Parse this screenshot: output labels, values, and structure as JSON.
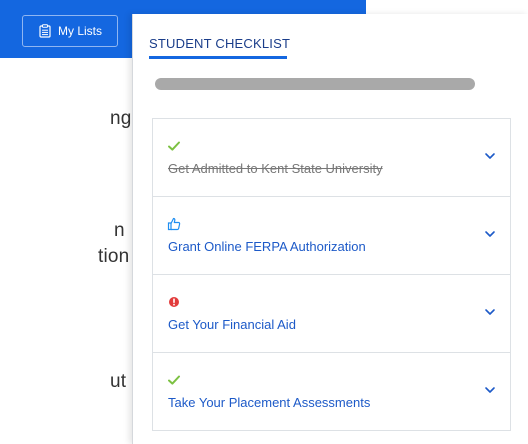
{
  "header": {
    "my_lists_label": "My Lists",
    "brand_color": "#1467e0"
  },
  "background_text": [
    "ng",
    "n",
    "tion",
    "ut"
  ],
  "checklist": {
    "title": "STUDENT CHECKLIST",
    "items": [
      {
        "label": "Get Admitted to Kent State University",
        "status": "check-icon",
        "completed": true
      },
      {
        "label": "Grant Online FERPA Authorization",
        "status": "thumbs-up-icon",
        "completed": false
      },
      {
        "label": "Get Your Financial Aid",
        "status": "alert-icon",
        "completed": false
      },
      {
        "label": "Take Your Placement Assessments",
        "status": "check-icon",
        "completed": false
      }
    ]
  },
  "colors": {
    "check": "#7cc142",
    "thumb": "#1f8ef1",
    "alert": "#e23b3b",
    "link": "#1d5ac8"
  }
}
